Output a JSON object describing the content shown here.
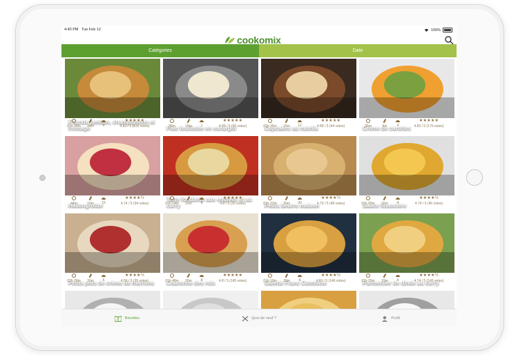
{
  "status": {
    "time": "4:40 PM",
    "date": "Tue Feb 12",
    "battery": "100%"
  },
  "header": {
    "logo": "cookomix"
  },
  "tabs": [
    {
      "label": "Catégories"
    },
    {
      "label": "Date"
    }
  ],
  "recipes": [
    {
      "title": "Friands jambon, champignons et fromage",
      "time": "01h 05m",
      "prep": "30m",
      "servings": "4",
      "rating": "4.83 / 5 (126 votes)",
      "stars": "★★★★★",
      "palette": [
        "#6a8a3a",
        "#c58a3a",
        "#e7c07a"
      ]
    },
    {
      "title": "Pâte feuilletée en escargot",
      "time": "35m",
      "prep": "15m",
      "servings": "1",
      "rating": "4.89 / 5 (92 votes)",
      "stars": "★★★★★",
      "palette": [
        "#555555",
        "#8a8a8a",
        "#efe7cf"
      ]
    },
    {
      "title": "Cupcakes au nutella",
      "time": "01h 35m",
      "prep": "15m",
      "servings": "12",
      "rating": "4.89 / 5 (44 votes)",
      "stars": "★★★★★",
      "palette": [
        "#3a2a20",
        "#7a4a2a",
        "#e8cda0"
      ]
    },
    {
      "title": "Crème de carottes",
      "time": "36m",
      "prep": "5m",
      "servings": "4",
      "rating": "4.83 / 5 (170 votes)",
      "stars": "★★★★★",
      "palette": [
        "#e8e8e8",
        "#f0a030",
        "#7aa040"
      ]
    },
    {
      "title": "Hallongrottor",
      "time": "44m",
      "prep": "10m",
      "servings": "15",
      "rating": "4.74 / 5 (34 votes)",
      "stars": "★★★★½",
      "palette": [
        "#d8a0a0",
        "#f5e0c0",
        "#c03040"
      ]
    },
    {
      "title": "Tarte fondante aux endives et au curry",
      "time": "01h 14m",
      "prep": "20m",
      "servings": "8",
      "rating": "4.8 / 5 (25 votes)",
      "stars": "★★★★★",
      "palette": [
        "#c03020",
        "#d89a40",
        "#e8d8a0"
      ]
    },
    {
      "title": "Petits beurre maison",
      "time": "01h 37m",
      "prep": "30m",
      "servings": "30",
      "rating": "4.73 / 5 (48 votes)",
      "stars": "★★★★½",
      "palette": [
        "#b88a50",
        "#d8b070",
        "#e8c890"
      ]
    },
    {
      "title": "Sauce financière",
      "time": "01h 05m",
      "prep": "15m",
      "servings": "4",
      "rating": "4.74 / 5 (40 votes)",
      "stars": "★★★★½",
      "palette": [
        "#e0e0e0",
        "#e0a830",
        "#f4c850"
      ]
    },
    {
      "title": "Petits pots de crème de marrons",
      "time": "02h 20m",
      "prep": "30m",
      "servings": "6",
      "rating": "4.56 / 5 (35 votes)",
      "stars": "★★★★½",
      "palette": [
        "#c8b090",
        "#e8d8c0",
        "#b03030"
      ]
    },
    {
      "title": "Couronne des rois",
      "time": "01h 48m",
      "prep": "20m",
      "servings": "8",
      "rating": "4.8 / 5 (145 votes)",
      "stars": "★★★★★",
      "palette": [
        "#e8e0d0",
        "#d8a050",
        "#c83030"
      ]
    },
    {
      "title": "Galette Franc Comtoise",
      "time": "01h 10m",
      "prep": "30m",
      "servings": "8",
      "rating": "4.69 / 5 (146 votes)",
      "stars": "★★★★½",
      "palette": [
        "#203040",
        "#d8a040",
        "#f0c060"
      ]
    },
    {
      "title": "Parmentier de dinde au curry",
      "time": "01h 25m",
      "prep": "15m",
      "servings": "4",
      "rating": "4.74 / 5 (145 votes)",
      "stars": "★★★★½",
      "palette": [
        "#7aa050",
        "#e0a840",
        "#f0d080"
      ]
    },
    {
      "title": "",
      "time": "",
      "prep": "",
      "servings": "",
      "rating": "",
      "stars": "",
      "palette": [
        "#e8e8e8",
        "#b0b0b0",
        "#f5f5f5"
      ]
    },
    {
      "title": "",
      "time": "",
      "prep": "",
      "servings": "",
      "rating": "",
      "stars": "",
      "palette": [
        "#f0f0f0",
        "#c8c8c8",
        "#e0e0e0"
      ]
    },
    {
      "title": "",
      "time": "",
      "prep": "",
      "servings": "",
      "rating": "",
      "stars": "",
      "palette": [
        "#d8a040",
        "#f0d080",
        "#e8c060"
      ]
    },
    {
      "title": "",
      "time": "",
      "prep": "",
      "servings": "",
      "rating": "",
      "stars": "",
      "palette": [
        "#e8e8e8",
        "#a0a0a0",
        "#f8f8f8"
      ]
    }
  ],
  "tabbar": [
    {
      "label": "Recettes",
      "icon": "book-icon"
    },
    {
      "label": "Quoi de neuf ?",
      "icon": "utensils-icon"
    },
    {
      "label": "Profil",
      "icon": "user-icon"
    }
  ],
  "colors": {
    "primary_green": "#5ea02f",
    "light_green": "#a3c24a",
    "meta_brown": "#8a6a3a"
  }
}
